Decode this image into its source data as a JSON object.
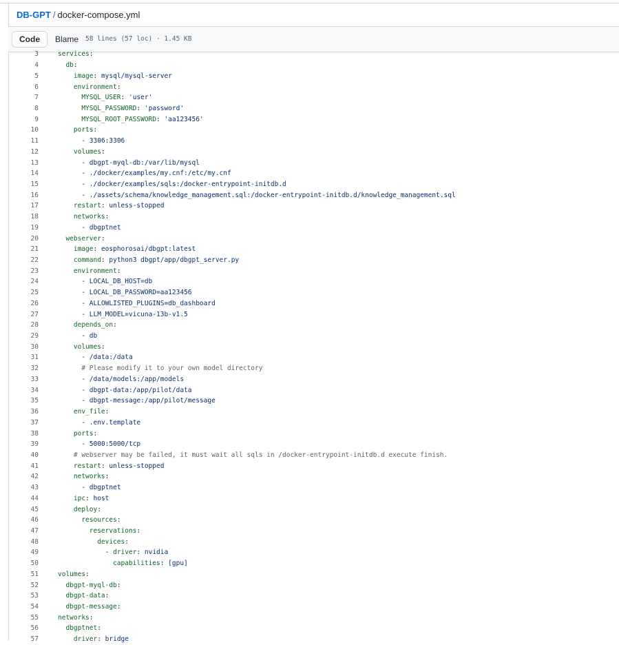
{
  "breadcrumb": {
    "repo": "DB-GPT",
    "separator": "/",
    "file": "docker-compose.yml"
  },
  "toolbar": {
    "tabs": [
      {
        "label": "Code",
        "active": true
      },
      {
        "label": "Blame",
        "active": false
      }
    ],
    "file_info": "58 lines (57 loc) · 1.45 KB"
  },
  "colors": {
    "key": "#116329",
    "string": "#0a3069",
    "comment": "#59636e",
    "link": "#0969da"
  },
  "code_lines": [
    {
      "n": "3",
      "indent": "",
      "key": "services",
      "sep": ":"
    },
    {
      "n": "4",
      "indent": "  ",
      "key": "db",
      "sep": ":"
    },
    {
      "n": "5",
      "indent": "    ",
      "key": "image",
      "sep": ": ",
      "val": "mysql/mysql-server"
    },
    {
      "n": "6",
      "indent": "    ",
      "key": "environment",
      "sep": ":"
    },
    {
      "n": "7",
      "indent": "      ",
      "key": "MYSQL_USER",
      "sep": ": ",
      "val": "'user'"
    },
    {
      "n": "8",
      "indent": "      ",
      "key": "MYSQL_PASSWORD",
      "sep": ": ",
      "val": "'password'"
    },
    {
      "n": "9",
      "indent": "      ",
      "key": "MYSQL_ROOT_PASSWORD",
      "sep": ": ",
      "val": "'aa123456'"
    },
    {
      "n": "10",
      "indent": "    ",
      "key": "ports",
      "sep": ":"
    },
    {
      "n": "11",
      "indent": "      ",
      "dash": "- ",
      "val": "3306:3306"
    },
    {
      "n": "12",
      "indent": "    ",
      "key": "volumes",
      "sep": ":"
    },
    {
      "n": "13",
      "indent": "      ",
      "dash": "- ",
      "val": "dbgpt-myql-db:/var/lib/mysql"
    },
    {
      "n": "14",
      "indent": "      ",
      "dash": "- ",
      "val": "./docker/examples/my.cnf:/etc/my.cnf"
    },
    {
      "n": "15",
      "indent": "      ",
      "dash": "- ",
      "val": "./docker/examples/sqls:/docker-entrypoint-initdb.d"
    },
    {
      "n": "16",
      "indent": "      ",
      "dash": "- ",
      "val": "./assets/schema/knowledge_management.sql:/docker-entrypoint-initdb.d/knowledge_management.sql"
    },
    {
      "n": "17",
      "indent": "    ",
      "key": "restart",
      "sep": ": ",
      "val": "unless-stopped"
    },
    {
      "n": "18",
      "indent": "    ",
      "key": "networks",
      "sep": ":"
    },
    {
      "n": "19",
      "indent": "      ",
      "dash": "- ",
      "val": "dbgptnet"
    },
    {
      "n": "20",
      "indent": "  ",
      "key": "webserver",
      "sep": ":"
    },
    {
      "n": "21",
      "indent": "    ",
      "key": "image",
      "sep": ": ",
      "val": "eosphorosai/dbgpt:latest"
    },
    {
      "n": "22",
      "indent": "    ",
      "key": "command",
      "sep": ": ",
      "val": "python3 dbgpt/app/dbgpt_server.py"
    },
    {
      "n": "23",
      "indent": "    ",
      "key": "environment",
      "sep": ":"
    },
    {
      "n": "24",
      "indent": "      ",
      "dash": "- ",
      "val": "LOCAL_DB_HOST=db"
    },
    {
      "n": "25",
      "indent": "      ",
      "dash": "- ",
      "val": "LOCAL_DB_PASSWORD=aa123456"
    },
    {
      "n": "26",
      "indent": "      ",
      "dash": "- ",
      "val": "ALLOWLISTED_PLUGINS=db_dashboard"
    },
    {
      "n": "27",
      "indent": "      ",
      "dash": "- ",
      "val": "LLM_MODEL=vicuna-13b-v1.5"
    },
    {
      "n": "28",
      "indent": "    ",
      "key": "depends_on",
      "sep": ":"
    },
    {
      "n": "29",
      "indent": "      ",
      "dash": "- ",
      "val": "db"
    },
    {
      "n": "30",
      "indent": "    ",
      "key": "volumes",
      "sep": ":"
    },
    {
      "n": "31",
      "indent": "      ",
      "dash": "- ",
      "val": "/data:/data"
    },
    {
      "n": "32",
      "indent": "      ",
      "comment": "# Please modify it to your own model directory"
    },
    {
      "n": "33",
      "indent": "      ",
      "dash": "- ",
      "val": "/data/models:/app/models"
    },
    {
      "n": "34",
      "indent": "      ",
      "dash": "- ",
      "val": "dbgpt-data:/app/pilot/data"
    },
    {
      "n": "35",
      "indent": "      ",
      "dash": "- ",
      "val": "dbgpt-message:/app/pilot/message"
    },
    {
      "n": "36",
      "indent": "    ",
      "key": "env_file",
      "sep": ":"
    },
    {
      "n": "37",
      "indent": "      ",
      "dash": "- ",
      "val": ".env.template"
    },
    {
      "n": "38",
      "indent": "    ",
      "key": "ports",
      "sep": ":"
    },
    {
      "n": "39",
      "indent": "      ",
      "dash": "- ",
      "val": "5000:5000/tcp"
    },
    {
      "n": "40",
      "indent": "    ",
      "comment": "# webserver may be failed, it must wait all sqls in /docker-entrypoint-initdb.d execute finish."
    },
    {
      "n": "41",
      "indent": "    ",
      "key": "restart",
      "sep": ": ",
      "val": "unless-stopped"
    },
    {
      "n": "42",
      "indent": "    ",
      "key": "networks",
      "sep": ":"
    },
    {
      "n": "43",
      "indent": "      ",
      "dash": "- ",
      "val": "dbgptnet"
    },
    {
      "n": "44",
      "indent": "    ",
      "key": "ipc",
      "sep": ": ",
      "val": "host"
    },
    {
      "n": "45",
      "indent": "    ",
      "key": "deploy",
      "sep": ":"
    },
    {
      "n": "46",
      "indent": "      ",
      "key": "resources",
      "sep": ":"
    },
    {
      "n": "47",
      "indent": "        ",
      "key": "reservations",
      "sep": ":"
    },
    {
      "n": "48",
      "indent": "          ",
      "key": "devices",
      "sep": ":"
    },
    {
      "n": "49",
      "indent": "            ",
      "dash": "- ",
      "key": "driver",
      "sep": ": ",
      "val": "nvidia"
    },
    {
      "n": "50",
      "indent": "              ",
      "key": "capabilities",
      "sep": ": ",
      "val": "[gpu]"
    },
    {
      "n": "51",
      "indent": "",
      "key": "volumes",
      "sep": ":"
    },
    {
      "n": "52",
      "indent": "  ",
      "key": "dbgpt-myql-db",
      "sep": ":"
    },
    {
      "n": "53",
      "indent": "  ",
      "key": "dbgpt-data",
      "sep": ":"
    },
    {
      "n": "54",
      "indent": "  ",
      "key": "dbgpt-message",
      "sep": ":"
    },
    {
      "n": "55",
      "indent": "",
      "key": "networks",
      "sep": ":"
    },
    {
      "n": "56",
      "indent": "  ",
      "key": "dbgptnet",
      "sep": ":"
    },
    {
      "n": "57",
      "indent": "    ",
      "key": "driver",
      "sep": ": ",
      "val": "bridge"
    }
  ]
}
